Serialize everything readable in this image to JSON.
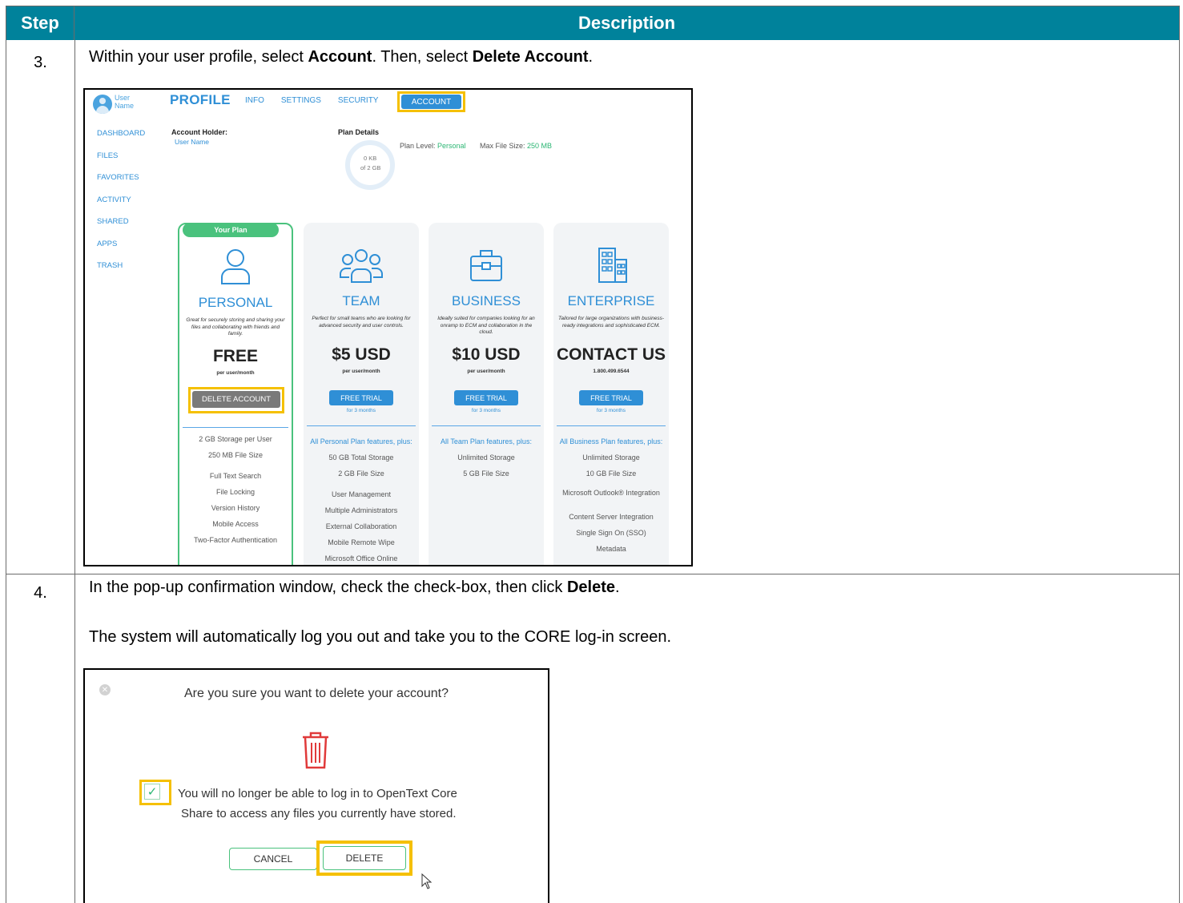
{
  "table": {
    "header_step": "Step",
    "header_description": "Description"
  },
  "steps": [
    {
      "num": "3.",
      "text_prefix": "Within your user profile, select ",
      "bold1": "Account",
      "text_mid": ". Then, select ",
      "bold2": "Delete Account",
      "text_suffix": "."
    },
    {
      "num": "4.",
      "text_prefix": "In the pop-up confirmation window, check the check-box, then click ",
      "bold1": "Delete",
      "text_suffix": ".",
      "line2": "The system will automatically log you out and take you to the CORE log-in screen."
    }
  ],
  "profile_screen": {
    "user_name": "User Name",
    "title": "PROFILE",
    "tabs": [
      "INFO",
      "SETTINGS",
      "SECURITY"
    ],
    "active_tab": "ACCOUNT",
    "nav": [
      "DASHBOARD",
      "FILES",
      "FAVORITES",
      "ACTIVITY",
      "SHARED",
      "APPS",
      "TRASH"
    ],
    "account_holder_label": "Account Holder:",
    "account_holder_value": "User Name",
    "plan_details_label": "Plan Details",
    "plan_level_label": "Plan Level: ",
    "plan_level_value": "Personal",
    "max_file_label": "Max File Size: ",
    "max_file_value": "250 MB",
    "usage_used": "0 KB",
    "usage_total": "of 2 GB",
    "plans": [
      {
        "badge": "Your Plan",
        "name": "PERSONAL",
        "desc": "Great for securely storing and sharing your files and collaborating with friends and family.",
        "price": "FREE",
        "per": "per user/month",
        "button": "DELETE ACCOUNT",
        "button_sub": "",
        "features_head": "",
        "features": [
          "2 GB Storage per User",
          "250 MB File Size",
          "Full Text Search",
          "File Locking",
          "Version History",
          "Mobile Access",
          "Two-Factor Authentication"
        ]
      },
      {
        "name": "TEAM",
        "desc": "Perfect for small teams who are looking for advanced security and user controls.",
        "price": "$5 USD",
        "per": "per user/month",
        "button": "FREE TRIAL",
        "button_sub": "for 3 months",
        "features_head": "All Personal Plan features, plus:",
        "features": [
          "50 GB Total Storage",
          "2 GB File Size",
          "User Management",
          "Multiple Administrators",
          "External Collaboration",
          "Mobile Remote Wipe",
          "Microsoft Office Online"
        ]
      },
      {
        "name": "BUSINESS",
        "desc": "Ideally suited for companies looking for an onramp to ECM and collaboration in the cloud.",
        "price": "$10 USD",
        "per": "per user/month",
        "button": "FREE TRIAL",
        "button_sub": "for 3 months",
        "features_head": "All Team Plan features, plus:",
        "features": [
          "Unlimited Storage",
          "5 GB File Size"
        ]
      },
      {
        "name": "ENTERPRISE",
        "desc": "Tailored for large organizations with business-ready integrations and sophisticated ECM.",
        "price": "CONTACT US",
        "per": "1.800.499.6544",
        "button": "FREE TRIAL",
        "button_sub": "for 3 months",
        "features_head": "All Business Plan features, plus:",
        "features": [
          "Unlimited Storage",
          "10 GB File Size",
          "Microsoft Outlook® Integration",
          "Content Server Integration",
          "Single Sign On (SSO)",
          "Metadata"
        ]
      }
    ]
  },
  "modal": {
    "question": "Are you sure you want to delete your account?",
    "check_line1": "You will no longer be able to log in to OpenText Core",
    "check_line2": "Share to access any files you currently have stored.",
    "cancel": "CANCEL",
    "delete": "DELETE",
    "checkbox_checked": true
  },
  "colors": {
    "header_bg": "#00829b",
    "accent_blue": "#2f8fd6",
    "accent_green": "#4ac27d",
    "highlight": "#f5c000",
    "trash_red": "#e03a3a"
  },
  "icons": [
    "close-icon",
    "trash-icon",
    "check-icon",
    "user-icon",
    "team-icon",
    "briefcase-icon",
    "building-icon",
    "cursor-icon"
  ]
}
